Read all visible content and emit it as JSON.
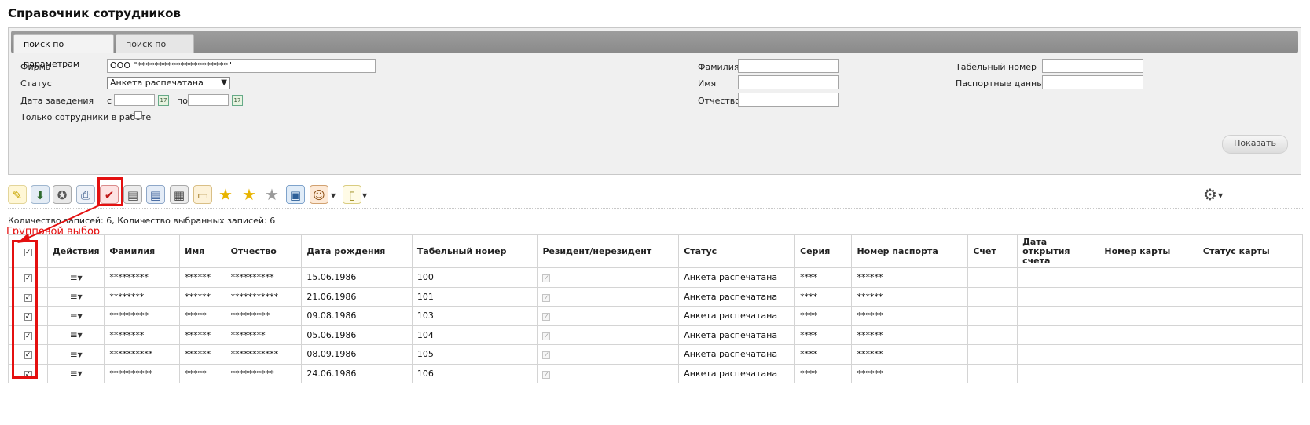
{
  "page_title": "Справочник сотрудников",
  "tabs": [
    {
      "label": "поиск по параметрам",
      "active": true
    },
    {
      "label": "поиск по списку",
      "active": false
    }
  ],
  "filters": {
    "firm_label": "Фирма",
    "firm_value": "ООО \"*********************\"",
    "status_label": "Статус",
    "status_value": "Анкета распечатана",
    "date_label": "Дата заведения",
    "date_from_label": "с",
    "date_to_label": "по",
    "date_from_value": "",
    "date_to_value": "",
    "only_working_label": "Только сотрудники в работе",
    "last_name_label": "Фамилия",
    "first_name_label": "Имя",
    "patronymic_label": "Отчество",
    "tab_number_label": "Табельный номер",
    "passport_label": "Паспортные данные",
    "show_button": "Показать"
  },
  "toolbar": {
    "icons": [
      "new-document-icon",
      "download-icon",
      "award-gray-icon",
      "print-icon",
      "award-check-icon",
      "id-card-icon",
      "id-card-blue-icon",
      "calculator-icon",
      "card-icon",
      "star-icon",
      "star-add-icon",
      "star-remove-icon",
      "window-icon",
      "users-icon",
      "document-icon",
      "settings-gear-icon"
    ]
  },
  "records_info": "Количество записей: 6, Количество выбранных записей: 6",
  "annotation_label": "Групповой выбор",
  "colors": {
    "highlight": "#e41010"
  },
  "table": {
    "headers": [
      "Действия",
      "Фамилия",
      "Имя",
      "Отчество",
      "Дата рождения",
      "Табельный номер",
      "Резидент/нерезидент",
      "Статус",
      "Серия",
      "Номер паспорта",
      "Счет",
      "Дата открытия счета",
      "Номер карты",
      "Статус карты"
    ],
    "rows": [
      {
        "last": "*********",
        "first": " ******",
        "middle": "**********",
        "dob": "15.06.1986",
        "tab": "100",
        "status": "Анкета распечатана",
        "series": " ****",
        "passport": "******"
      },
      {
        "last": "  ********",
        "first": " ******",
        "middle": " ***********",
        "dob": "21.06.1986",
        "tab": "101",
        "status": "Анкета распечатана",
        "series": " ****",
        "passport": " ******"
      },
      {
        "last": " *********",
        "first": "*****",
        "middle": " *********",
        "dob": "09.08.1986",
        "tab": "103",
        "status": "Анкета распечатана",
        "series": "****",
        "passport": " ******"
      },
      {
        "last": " ********",
        "first": " ******",
        "middle": "   ********",
        "dob": "05.06.1986",
        "tab": "104",
        "status": "Анкета распечатана",
        "series": " ****",
        "passport": "******"
      },
      {
        "last": " **********",
        "first": " ******",
        "middle": " ***********",
        "dob": "08.09.1986",
        "tab": "105",
        "status": "Анкета распечатана",
        "series": " ****",
        "passport": "  ******"
      },
      {
        "last": " **********",
        "first": " *****",
        "middle": "**********",
        "dob": "24.06.1986",
        "tab": "106",
        "status": "Анкета распечатана",
        "series": " ****",
        "passport": "  ******"
      }
    ]
  }
}
